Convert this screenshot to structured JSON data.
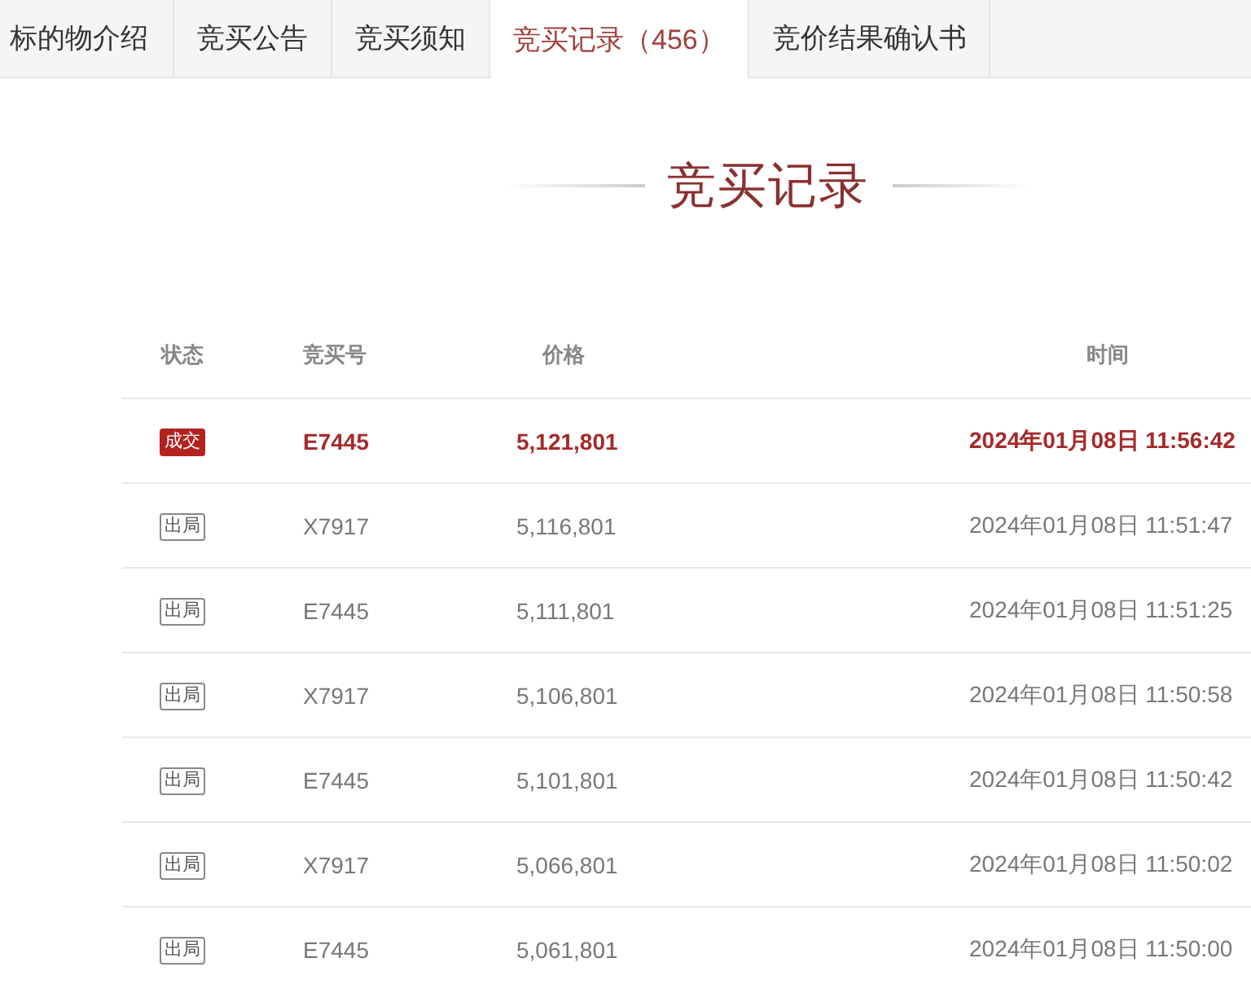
{
  "tabs": [
    {
      "label": "标的物介绍",
      "selected": false
    },
    {
      "label": "竞买公告",
      "selected": false
    },
    {
      "label": "竞买须知",
      "selected": false
    },
    {
      "label": "竞买记录（456）",
      "selected": true
    },
    {
      "label": "竞价结果确认书",
      "selected": false
    }
  ],
  "section_title": "竞买记录",
  "table": {
    "columns": [
      "状态",
      "竞买号",
      "价格",
      "时间"
    ],
    "rows": [
      {
        "kind": "won",
        "status": "成交",
        "bidder": "E7445",
        "price": "5,121,801",
        "time": "2024年01月08日 11:56:42"
      },
      {
        "kind": "out",
        "status": "出局",
        "bidder": "X7917",
        "price": "5,116,801",
        "time": "2024年01月08日 11:51:47"
      },
      {
        "kind": "out",
        "status": "出局",
        "bidder": "E7445",
        "price": "5,111,801",
        "time": "2024年01月08日 11:51:25"
      },
      {
        "kind": "out",
        "status": "出局",
        "bidder": "X7917",
        "price": "5,106,801",
        "time": "2024年01月08日 11:50:58"
      },
      {
        "kind": "out",
        "status": "出局",
        "bidder": "E7445",
        "price": "5,101,801",
        "time": "2024年01月08日 11:50:42"
      },
      {
        "kind": "out",
        "status": "出局",
        "bidder": "X7917",
        "price": "5,066,801",
        "time": "2024年01月08日 11:50:02"
      },
      {
        "kind": "out",
        "status": "出局",
        "bidder": "E7445",
        "price": "5,061,801",
        "time": "2024年01月08日 11:50:00"
      }
    ]
  }
}
